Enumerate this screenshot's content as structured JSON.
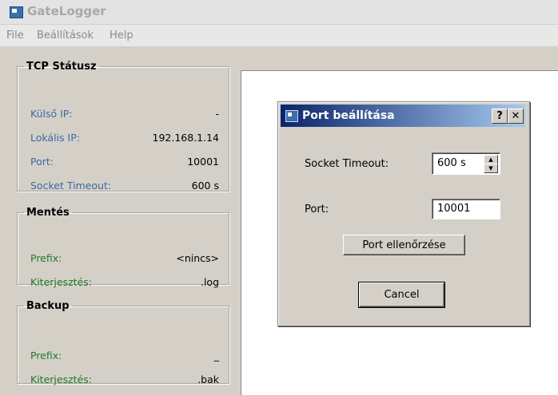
{
  "window": {
    "title": "GateLogger"
  },
  "menu": [
    "File",
    "Beállítások",
    "Help"
  ],
  "tcp": {
    "legend": "TCP Státusz",
    "rows": [
      {
        "label": "Külső IP:",
        "value": "-"
      },
      {
        "label": "Lokális IP:",
        "value": "192.168.1.14"
      },
      {
        "label": "Port:",
        "value": "10001"
      },
      {
        "label": "Socket Timeout:",
        "value": "600 s"
      }
    ]
  },
  "mentes": {
    "legend": "Mentés",
    "rows": [
      {
        "label": "Prefix:",
        "value": "<nincs>"
      },
      {
        "label": "Kiterjesztés:",
        "value": ".log"
      }
    ]
  },
  "backup": {
    "legend": "Backup",
    "rows": [
      {
        "label": "Prefix:",
        "value": "_"
      },
      {
        "label": "Kiterjesztés:",
        "value": ".bak"
      }
    ]
  },
  "dialog": {
    "title": "Port beállítása",
    "help_glyph": "?",
    "close_glyph": "✕",
    "timeout_label": "Socket Timeout:",
    "timeout_value": "600 s",
    "port_label": "Port:",
    "port_value": "10001",
    "check_button": "Port ellenőrzése",
    "cancel_button": "Cancel"
  },
  "colors": {
    "label_blue": "#3a6aa3",
    "label_green": "#1f7a2a",
    "dialog_title": "#0a246a"
  }
}
